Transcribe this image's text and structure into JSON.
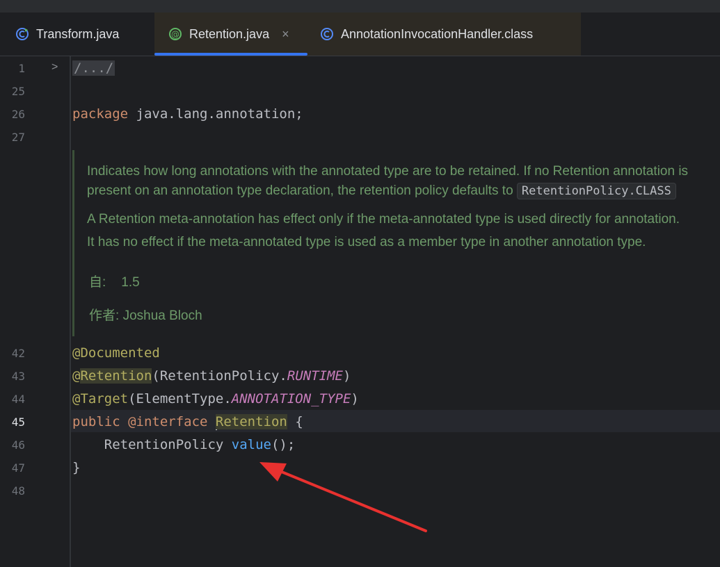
{
  "tabs": [
    {
      "label": "Transform.java",
      "icon": "class-refresh-icon"
    },
    {
      "label": "Retention.java",
      "icon": "annotation-icon",
      "close": "×"
    },
    {
      "label": "AnnotationInvocationHandler.class",
      "icon": "class-icon"
    }
  ],
  "gutter": {
    "fold_arrow": ">",
    "line_numbers": [
      "1",
      "25",
      "26",
      "27",
      "42",
      "43",
      "44",
      "45",
      "46",
      "47",
      "48"
    ]
  },
  "code": {
    "folded": "/.../",
    "package_kw": "package",
    "package_name": " java.lang.annotation;",
    "documented": "@Documented",
    "retention_at": "@",
    "retention_name": "Retention",
    "retention_open": "(RetentionPolicy.",
    "runtime": "RUNTIME",
    "close_paren": ")",
    "target": "@Target",
    "target_open": "(ElementType.",
    "annotation_type": "ANNOTATION_TYPE",
    "public_kw": "public",
    "interface_kw": " @interface ",
    "class_name": "Retention",
    "brace_open": " {",
    "indent_type": "    RetentionPolicy ",
    "method": "value",
    "method_end": "();",
    "brace_close": "}"
  },
  "doc": {
    "line1": "Indicates how long annotations with the annotated type are to be retained. If no Retention annotation is",
    "line2_text": "present on an annotation type declaration, the retention policy defaults to ",
    "line2_code": "RetentionPolicy.CLASS",
    "line3": "A Retention meta-annotation has effect only if the meta-annotated type is used directly for annotation.",
    "line4": "It has no effect if the meta-annotated type is used as a member type in another annotation type.",
    "since_label": "自:",
    "since_value": "1.5",
    "author_label": "作者:",
    "author_value": "Joshua Bloch"
  },
  "colors": {
    "arrow": "#e8312f",
    "accent": "#3574f0"
  }
}
